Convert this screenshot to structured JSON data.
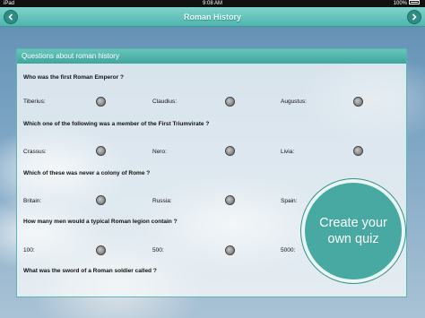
{
  "status_bar": {
    "left": "iPad",
    "time": "9:08 AM",
    "battery": "100%"
  },
  "nav": {
    "title": "Roman History"
  },
  "panel": {
    "header": "Questions about roman history",
    "questions": [
      {
        "text": "Who was the first Roman Emperor ?",
        "options": [
          "Tiberius:",
          "Claudius:",
          "Augustus:"
        ]
      },
      {
        "text": "Which one of the following was a member of the First Triumvirate ?",
        "options": [
          "Crassus:",
          "Nero:",
          "Livia:"
        ]
      },
      {
        "text": "Which of these was never a colony of Rome ?",
        "options": [
          "Britain:",
          "Russia:",
          "Spain:"
        ]
      },
      {
        "text": "How many men would a typical Roman legion contain ?",
        "options": [
          "100:",
          "500:",
          "5000:"
        ]
      },
      {
        "text": "What was the sword of a Roman soldier called ?",
        "options": []
      }
    ]
  },
  "cta": {
    "line1": "Create your",
    "line2": "own quiz"
  },
  "colors": {
    "accent": "#4fb5ad",
    "cta": "#47a9a2"
  }
}
